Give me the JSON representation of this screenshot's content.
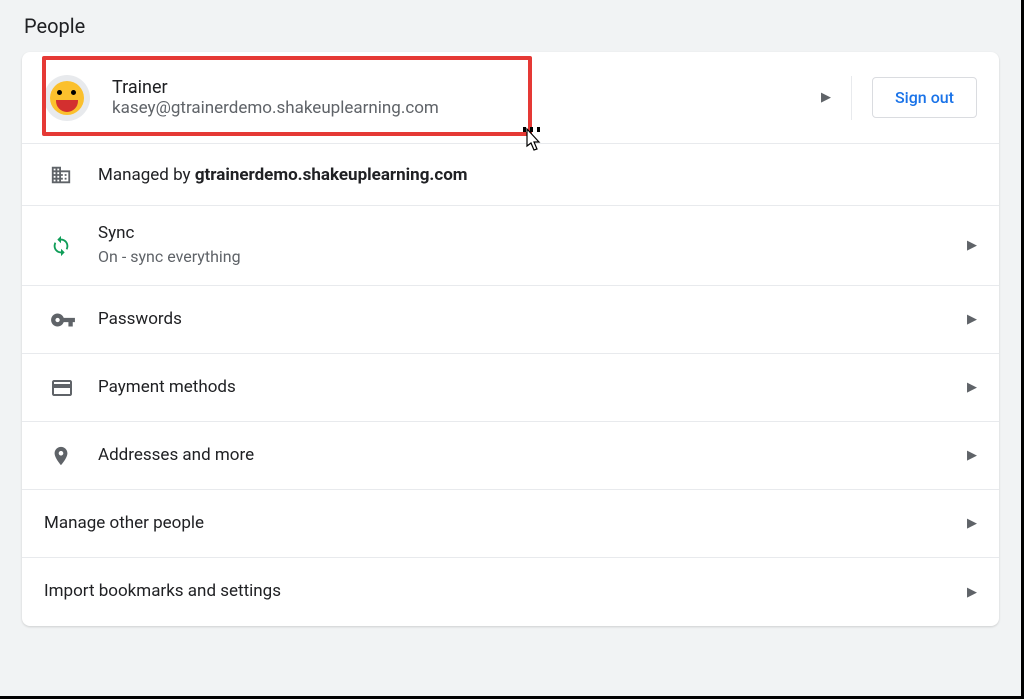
{
  "section_header": "People",
  "profile": {
    "name": "Trainer",
    "email": "kasey@gtrainerdemo.shakeuplearning.com"
  },
  "signout_label": "Sign out",
  "managed": {
    "prefix": "Managed by ",
    "domain": "gtrainerdemo.shakeuplearning.com"
  },
  "sync": {
    "title": "Sync",
    "status": "On - sync everything"
  },
  "items": {
    "passwords": "Passwords",
    "payment": "Payment methods",
    "addresses": "Addresses and more",
    "manage_people": "Manage other people",
    "import": "Import bookmarks and settings"
  }
}
